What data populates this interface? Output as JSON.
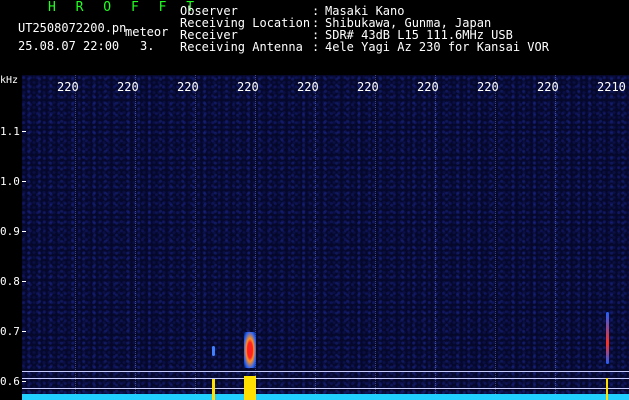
{
  "header": {
    "app_title": "H R O F F T",
    "file_name": "UT2508072200.pn",
    "file_tag": "meteor",
    "date_time": "25.08.07 22:00",
    "count": "3."
  },
  "meta": [
    {
      "label": "Observer",
      "value": "Masaki Kano"
    },
    {
      "label": "Receiving Location",
      "value": "Shibukawa, Gunma, Japan"
    },
    {
      "label": "Receiver",
      "value": "SDR# 43dB L15 111.6MHz USB"
    },
    {
      "label": "Receiving Antenna",
      "value": "4ele Yagi Az 230 for Kansai VOR"
    }
  ],
  "axes": {
    "y_unit": "kHz",
    "y_ticks": [
      "1.1",
      "1.0",
      "0.9",
      "0.8",
      "0.7",
      "0.6"
    ],
    "x_ticks": [
      "220",
      "220",
      "220",
      "220",
      "220",
      "220",
      "220",
      "220",
      "220",
      "2210"
    ]
  },
  "colors": {
    "background": "#000000",
    "waterfall": "#05082a",
    "baseline": "#22d0ff",
    "spike": "#ffe000",
    "title_green": "#22ff22"
  }
}
